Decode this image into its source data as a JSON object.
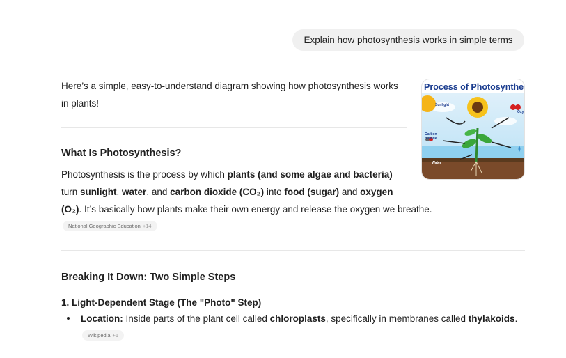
{
  "user_message": "Explain how photosynthesis works in simple terms",
  "intro": {
    "line1": "Here’s a simple, easy-to-understand diagram showing how photosynthesis works",
    "line2": "in plants!"
  },
  "image": {
    "title": "Process of Photosynthes",
    "labels": {
      "sunlight": "Sunlight",
      "carbon": "Carbon",
      "dioxide": "dioxide",
      "water": "Water",
      "oxy": "Oxy"
    }
  },
  "section1": {
    "heading": "What Is Photosynthesis?",
    "l1_a": "Photosynthesis is the process by which ",
    "l1_b": "plants (and some algae and bacteria)",
    "l2_a": "turn ",
    "l2_b": "sunlight",
    "l2_c": ", ",
    "l2_d": "water",
    "l2_e": ", and ",
    "l2_f": "carbon dioxide (CO₂)",
    "l2_g": " into ",
    "l2_h": "food (sugar)",
    "l2_i": " and ",
    "l2_j": "oxygen",
    "l3_a": "(O₂)",
    "l3_b": ". It’s basically how plants make their own energy and release the oxygen we breathe.",
    "source_chip": "National Geographic Education",
    "source_more": "+14"
  },
  "section2": {
    "heading": "Breaking It Down: Two Simple Steps",
    "step1_heading": "1. Light-Dependent Stage (The \"Photo\" Step)",
    "bullet_label": "Location:",
    "bullet_a": " Inside parts of the plant cell called ",
    "bullet_b": "chloroplasts",
    "bullet_c": ", specifically in membranes called ",
    "bullet_d": "thylakoids",
    "bullet_e": ".",
    "source_chip": "Wikipedia",
    "source_more": "+1"
  }
}
